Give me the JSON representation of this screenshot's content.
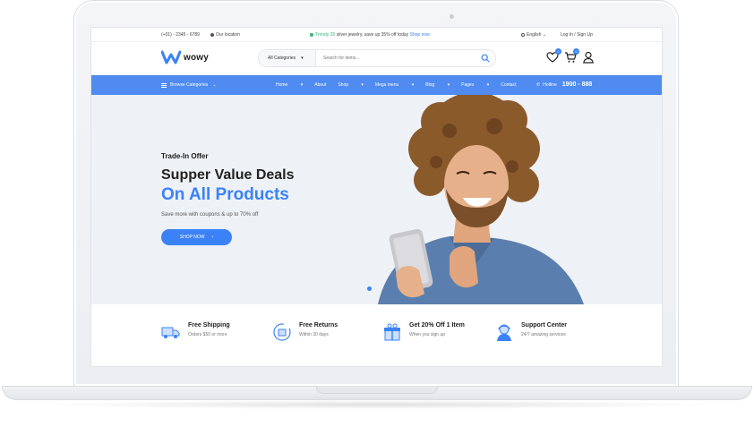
{
  "topbar": {
    "phone": "(+01) - 2345 - 6789",
    "location": "Our location",
    "promo_highlight": "Trendy 25",
    "promo_text": " silver jewelry, save up 35% off today ",
    "promo_link": "Shop now",
    "language": "English",
    "auth": "Log In / Sign Up"
  },
  "header": {
    "logo": "wowy",
    "category_select": "All Categories",
    "search_placeholder": "Search for items...",
    "wishlist_count": "0",
    "cart_count": "0"
  },
  "nav": {
    "browse": "Browse Categories",
    "items": [
      "Home",
      "About",
      "Shop",
      "Mega menu",
      "Blog",
      "Pages",
      "Contact"
    ],
    "hotline_label": "Hotline",
    "hotline_number": "1900 - 888"
  },
  "hero": {
    "subtitle": "Trade-In Offer",
    "title_line1": "Supper Value Deals",
    "title_line2": "On All Products",
    "description": "Save more with coupons & up to 70% off",
    "button": "SHOP NOW"
  },
  "features": [
    {
      "title": "Free Shipping",
      "desc": "Orders $50 or more"
    },
    {
      "title": "Free Returns",
      "desc": "Within 30 days"
    },
    {
      "title": "Get 20% Off 1 Item",
      "desc": "When you sign up"
    },
    {
      "title": "Support Center",
      "desc": "24/7 amazing services"
    }
  ],
  "colors": {
    "accent": "#3b82f6",
    "nav_bg": "#4f8bf0",
    "hero_bg": "#eef1f6",
    "promo_green": "#3bb77e"
  }
}
